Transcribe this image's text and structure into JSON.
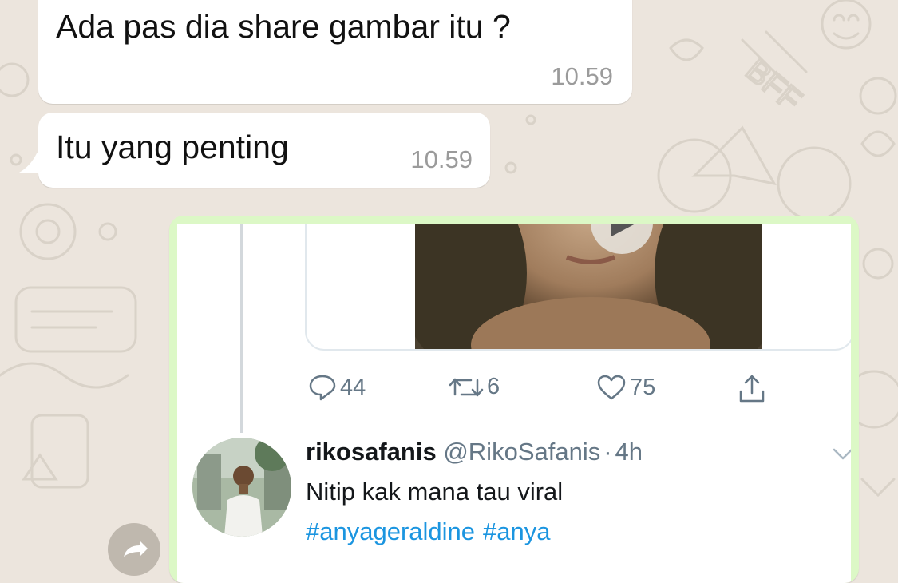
{
  "messages": [
    {
      "text": "Ada pas dia share gambar itu ?",
      "time": "10.59"
    },
    {
      "text": "Itu yang penting",
      "time": "10.59"
    }
  ],
  "tweet_screenshot": {
    "stats": {
      "replies": "44",
      "retweets": "6",
      "likes": "75"
    },
    "reply": {
      "name": "rikosafanis",
      "handle": "@RikoSafanis",
      "separator": "·",
      "age": "4h",
      "text": "Nitip kak mana tau viral",
      "hashtags": [
        "#anyageraldine",
        "#anya"
      ]
    }
  },
  "colors": {
    "chat_background": "#ece5dd",
    "incoming_bubble": "#ffffff",
    "outgoing_bubble": "#dcf8c6",
    "twitter_blue": "#1b95e0",
    "twitter_gray": "#657786"
  },
  "icons": [
    "reply-icon",
    "retweet-icon",
    "like-icon",
    "share-icon",
    "play-icon",
    "chevron-down-icon",
    "forward-icon"
  ]
}
